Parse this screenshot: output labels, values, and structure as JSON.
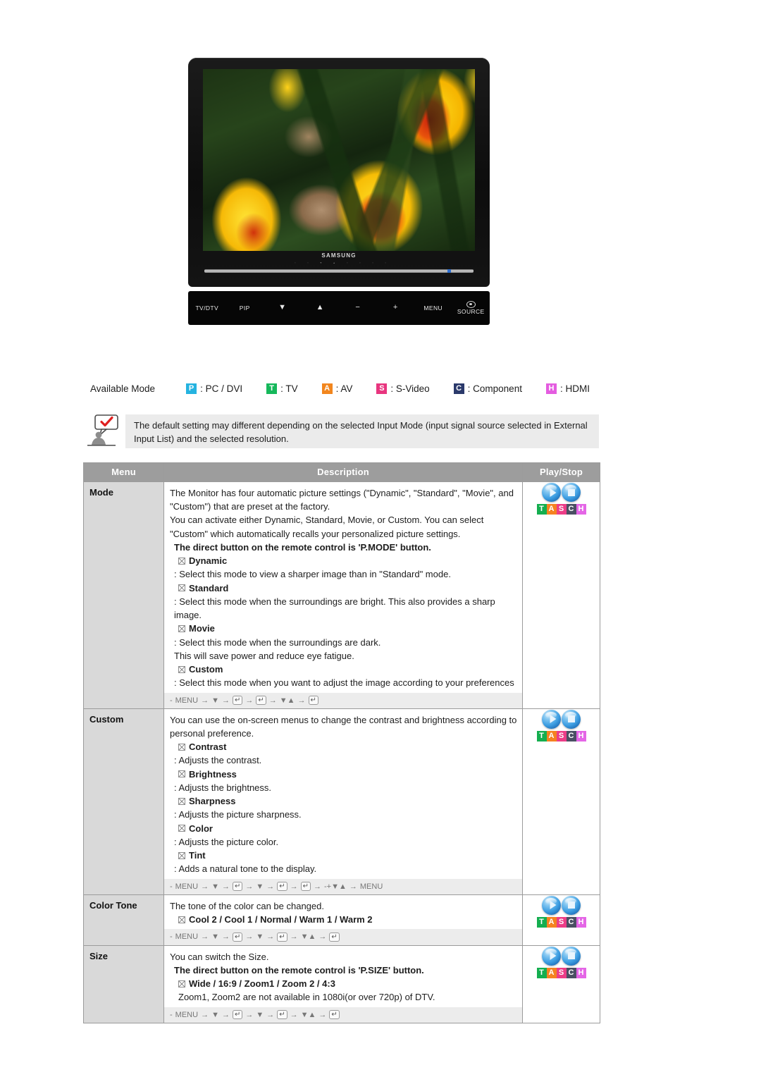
{
  "monitor": {
    "brand": "SAMSUNG",
    "controls": [
      {
        "label": "TV/DTV",
        "icon": "tv-dtv-button"
      },
      {
        "label": "PIP",
        "icon": "pip-button"
      },
      {
        "label": "▼",
        "icon": "down-arrow-button"
      },
      {
        "label": "▲",
        "icon": "up-arrow-button"
      },
      {
        "label": "−",
        "icon": "minus-button"
      },
      {
        "label": "+",
        "icon": "plus-button"
      },
      {
        "label": "MENU",
        "icon": "menu-button"
      },
      {
        "label": "SOURCE",
        "icon": "source-button"
      }
    ]
  },
  "available_mode": {
    "label": "Available Mode",
    "entries": [
      {
        "badge": "P",
        "text": ": PC / DVI",
        "color": "#25b3e0"
      },
      {
        "badge": "T",
        "text": ": TV",
        "color": "#16b85b"
      },
      {
        "badge": "A",
        "text": ": AV",
        "color": "#f2861e"
      },
      {
        "badge": "S",
        "text": ": S-Video",
        "color": "#e8357f"
      },
      {
        "badge": "C",
        "text": ": Component",
        "color": "#2b3a6b"
      },
      {
        "badge": "H",
        "text": ": HDMI",
        "color": "#e45ce0"
      }
    ]
  },
  "note": {
    "icon": "note-person-check-icon",
    "text": "The default setting may different depending on the selected Input Mode (input signal source selected in External Input List) and the selected resolution."
  },
  "table": {
    "headers": [
      "Menu",
      "Description",
      "Play/Stop"
    ],
    "rows": [
      {
        "menu": "Mode",
        "intro": [
          "The Monitor has four automatic picture settings (\"Dynamic\", \"Standard\", \"Movie\", and \"Custom\") that are preset at the factory.",
          "You can activate either Dynamic, Standard, Movie, or Custom. You can select \"Custom\" which automatically recalls your personalized picture settings."
        ],
        "bold_note": "The direct button on the remote control is 'P.MODE' button.",
        "items": [
          {
            "name": "Dynamic",
            "desc": ": Select this mode to view a sharper image than in \"Standard\" mode."
          },
          {
            "name": "Standard",
            "desc": ": Select this mode when the surroundings are bright. This also provides a sharp image."
          },
          {
            "name": "Movie",
            "desc": ": Select this mode when the surroundings are dark.\nThis will save power and reduce eye fatigue."
          },
          {
            "name": "Custom",
            "desc": ": Select this mode when you want to adjust the image according to your preferences"
          }
        ],
        "navpath": [
          "-",
          "MENU",
          "→",
          "▼",
          "→",
          "↵",
          "→",
          "↵",
          "→",
          "▼▲",
          "→",
          "↵"
        ],
        "play_stop": "TASCH"
      },
      {
        "menu": "Custom",
        "intro": [
          "You can use the on-screen menus to change the contrast and brightness according to personal preference."
        ],
        "items": [
          {
            "name": "Contrast",
            "desc": ": Adjusts the contrast."
          },
          {
            "name": "Brightness",
            "desc": ": Adjusts the brightness."
          },
          {
            "name": "Sharpness",
            "desc": ": Adjusts the picture sharpness."
          },
          {
            "name": "Color",
            "desc": ": Adjusts the picture color."
          },
          {
            "name": "Tint",
            "desc": ": Adds a natural tone to the display."
          }
        ],
        "navpath": [
          "-",
          "MENU",
          "→",
          "▼",
          "→",
          "↵",
          "→",
          "▼",
          "→",
          "↵",
          "→",
          "↵",
          "→",
          "-+▼▲",
          "→",
          "MENU"
        ],
        "play_stop": "TASCH"
      },
      {
        "menu": "Color Tone",
        "intro": [
          "The tone of the color can be changed."
        ],
        "items": [
          {
            "name": "Cool 2 / Cool 1 / Normal / Warm 1 / Warm 2",
            "desc": ""
          }
        ],
        "navpath": [
          "-",
          "MENU",
          "→",
          "▼",
          "→",
          "↵",
          "→",
          "▼",
          "→",
          "↵",
          "→",
          "▼▲",
          "→",
          "↵"
        ],
        "play_stop": "TASCH"
      },
      {
        "menu": "Size",
        "intro": [
          "You can switch the Size."
        ],
        "bold_note": "The direct button on the remote control is 'P.SIZE' button.",
        "items": [
          {
            "name": "Wide / 16:9 / Zoom1 / Zoom 2 / 4:3",
            "desc": "Zoom1, Zoom2 are not available in 1080i(or over 720p) of DTV."
          }
        ],
        "navpath": [
          "-",
          "MENU",
          "→",
          "▼",
          "→",
          "↵",
          "→",
          "▼",
          "→",
          "↵",
          "→",
          "▼▲",
          "→",
          "↵"
        ],
        "play_stop": "TASCH"
      }
    ]
  },
  "tasch": {
    "letters": [
      {
        "ch": "T",
        "color": "#14ae4f"
      },
      {
        "ch": "A",
        "color": "#f58220"
      },
      {
        "ch": "S",
        "color": "#ec3d87"
      },
      {
        "ch": "C",
        "color": "#4a4f63"
      },
      {
        "ch": "H",
        "color": "#e466e6"
      }
    ],
    "play_label": "Play",
    "stop_label": "Stop"
  }
}
